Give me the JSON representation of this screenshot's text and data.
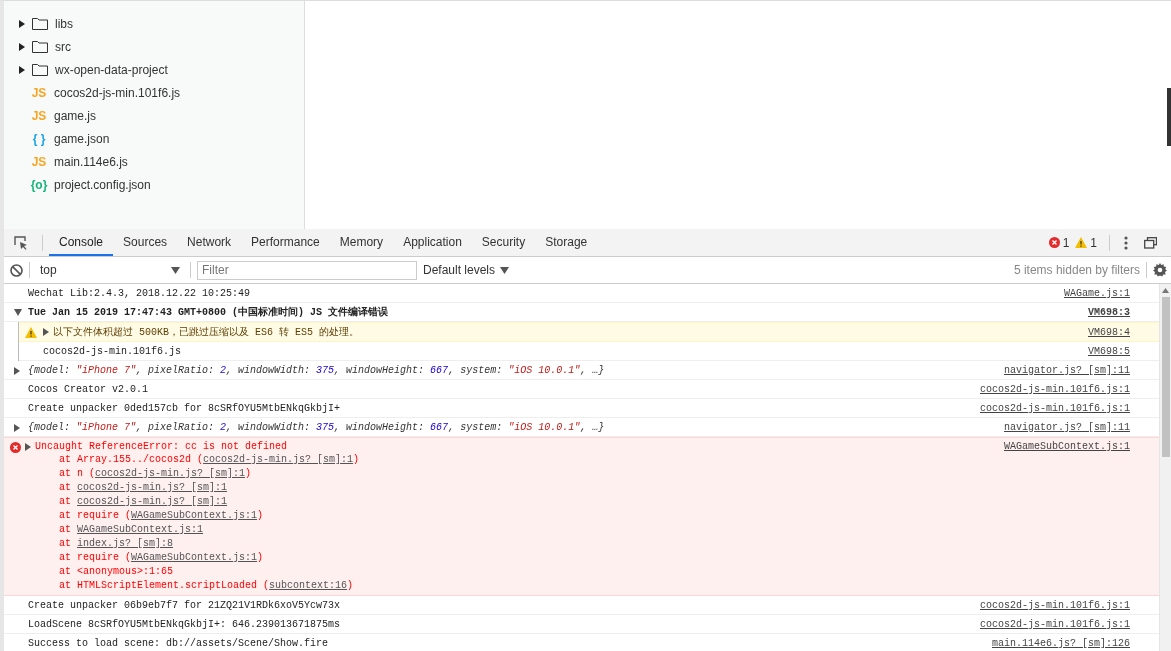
{
  "files": [
    {
      "name": "libs",
      "kind": "folder",
      "expanded": false
    },
    {
      "name": "src",
      "kind": "folder",
      "expanded": false
    },
    {
      "name": "wx-open-data-project",
      "kind": "folder",
      "expanded": false
    },
    {
      "name": "cocos2d-js-min.101f6.js",
      "kind": "js",
      "icon_text": "JS"
    },
    {
      "name": "game.js",
      "kind": "js",
      "icon_text": "JS"
    },
    {
      "name": "game.json",
      "kind": "json",
      "icon_text": "{ }"
    },
    {
      "name": "main.114e6.js",
      "kind": "js",
      "icon_text": "JS"
    },
    {
      "name": "project.config.json",
      "kind": "config",
      "icon_text": "{o}"
    }
  ],
  "tabs": [
    {
      "label": "Console",
      "selected": true
    },
    {
      "label": "Sources",
      "selected": false
    },
    {
      "label": "Network",
      "selected": false
    },
    {
      "label": "Performance",
      "selected": false
    },
    {
      "label": "Memory",
      "selected": false
    },
    {
      "label": "Application",
      "selected": false
    },
    {
      "label": "Security",
      "selected": false
    },
    {
      "label": "Storage",
      "selected": false
    }
  ],
  "counters": {
    "errors": "1",
    "warnings": "1"
  },
  "toolbar": {
    "context": "top",
    "filter_placeholder": "Filter",
    "levels": "Default levels",
    "hidden": "5 items hidden by filters"
  },
  "messages": [
    {
      "kind": "log",
      "text": "Wechat Lib:2.4.3, 2018.12.22 10:25:49",
      "source": "WAGame.js:1"
    },
    {
      "kind": "group",
      "expanded": true,
      "text": "Tue Jan 15 2019 17:47:43 GMT+0800 (中国标准时间) JS 文件编译错误",
      "source": "VM698:3",
      "children": [
        {
          "kind": "warning",
          "expanded": false,
          "text": "以下文件体积超过 500KB，已跳过压缩以及 ES6 转 ES5 的处理。",
          "source": "VM698:4"
        },
        {
          "kind": "log",
          "text": "cocos2d-js-min.101f6.js",
          "source": "VM698:5"
        }
      ]
    },
    {
      "kind": "object",
      "expanded": false,
      "tokens": [
        {
          "text": "{model: ",
          "kind": "plain"
        },
        {
          "text": "\"iPhone 7\"",
          "kind": "string"
        },
        {
          "text": ", pixelRatio: ",
          "kind": "plain"
        },
        {
          "text": "2",
          "kind": "number"
        },
        {
          "text": ", windowWidth: ",
          "kind": "plain"
        },
        {
          "text": "375",
          "kind": "number"
        },
        {
          "text": ", windowHeight: ",
          "kind": "plain"
        },
        {
          "text": "667",
          "kind": "number"
        },
        {
          "text": ", system: ",
          "kind": "plain"
        },
        {
          "text": "\"iOS 10.0.1\"",
          "kind": "string"
        },
        {
          "text": ", …}",
          "kind": "plain"
        }
      ],
      "source": "navigator.js? [sm]:11"
    },
    {
      "kind": "log",
      "text": "Cocos Creator v2.0.1",
      "source": "cocos2d-js-min.101f6.js:1"
    },
    {
      "kind": "log",
      "text": "Create unpacker 0ded157cb for 8cSRfOYU5MtbENkqGkbjI+",
      "source": "cocos2d-js-min.101f6.js:1"
    },
    {
      "kind": "object",
      "expanded": false,
      "tokens": [
        {
          "text": "{model: ",
          "kind": "plain"
        },
        {
          "text": "\"iPhone 7\"",
          "kind": "string"
        },
        {
          "text": ", pixelRatio: ",
          "kind": "plain"
        },
        {
          "text": "2",
          "kind": "number"
        },
        {
          "text": ", windowWidth: ",
          "kind": "plain"
        },
        {
          "text": "375",
          "kind": "number"
        },
        {
          "text": ", windowHeight: ",
          "kind": "plain"
        },
        {
          "text": "667",
          "kind": "number"
        },
        {
          "text": ", system: ",
          "kind": "plain"
        },
        {
          "text": "\"iOS 10.0.1\"",
          "kind": "string"
        },
        {
          "text": ", …}",
          "kind": "plain"
        }
      ],
      "source": "navigator.js? [sm]:11"
    },
    {
      "kind": "error",
      "expanded": false,
      "text": "Uncaught ReferenceError: cc is not defined",
      "source": "WAGameSubContext.js:1",
      "stack": [
        {
          "prefix": "at Array.155../cocos2d (",
          "link": "cocos2d-js-min.js? [sm]:1",
          "suffix": ")"
        },
        {
          "prefix": "at n (",
          "link": "cocos2d-js-min.js? [sm]:1",
          "suffix": ")"
        },
        {
          "prefix": "at ",
          "link": "cocos2d-js-min.js? [sm]:1"
        },
        {
          "prefix": "at ",
          "link": "cocos2d-js-min.js? [sm]:1"
        },
        {
          "prefix": "at require (",
          "link": "WAGameSubContext.js:1",
          "suffix": ")"
        },
        {
          "prefix": "at ",
          "link": "WAGameSubContext.js:1"
        },
        {
          "prefix": "at ",
          "link": "index.js? [sm]:8"
        },
        {
          "prefix": "at require (",
          "link": "WAGameSubContext.js:1",
          "suffix": ")"
        },
        {
          "prefix": "at <anonymous>:1:65"
        },
        {
          "prefix": "at HTMLScriptElement.scriptLoaded (",
          "link": "subcontext:16",
          "suffix": ")"
        }
      ]
    },
    {
      "kind": "log",
      "text": "Create unpacker 06b9eb7f7 for 21ZQ21V1RDk6xoV5Ycw73x",
      "source": "cocos2d-js-min.101f6.js:1"
    },
    {
      "kind": "log",
      "text": "LoadScene 8cSRfOYU5MtbENkqGkbjI+: 646.239013671875ms",
      "source": "cocos2d-js-min.101f6.js:1"
    },
    {
      "kind": "log",
      "text": "Success to load scene: db://assets/Scene/Show.fire",
      "source": "main.114e6.js? [sm]:126"
    }
  ]
}
